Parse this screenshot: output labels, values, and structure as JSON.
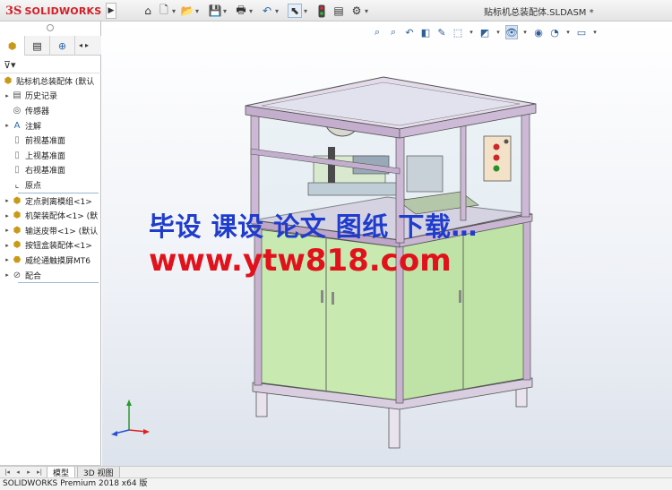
{
  "app": {
    "brand_mark": "3S",
    "brand_name": "SOLIDWORKS",
    "document_title": "贴标机总装配体.SLDASM *"
  },
  "toolbar": {
    "icons": [
      "home-icon",
      "new-file-icon",
      "open-icon",
      "save-icon",
      "print-icon",
      "undo-icon",
      "select-icon",
      "rebuild-icon",
      "file-properties-icon",
      "options-icon"
    ]
  },
  "panel": {
    "tabs": [
      "feature-manager",
      "property-manager"
    ],
    "root_label": "贴标机总装配体 (默认",
    "items": [
      {
        "label": "历史记录",
        "icon": "history-icon",
        "expand": "▸"
      },
      {
        "label": "传感器",
        "icon": "sensor-icon",
        "expand": ""
      },
      {
        "label": "注解",
        "icon": "annotation-icon",
        "expand": "▸"
      },
      {
        "label": "前视基准面",
        "icon": "plane-icon",
        "expand": ""
      },
      {
        "label": "上视基准面",
        "icon": "plane-icon",
        "expand": ""
      },
      {
        "label": "右视基准面",
        "icon": "plane-icon",
        "expand": ""
      },
      {
        "label": "原点",
        "icon": "origin-icon",
        "expand": ""
      },
      {
        "label": "定点剥离模组<1>",
        "icon": "subassembly-icon",
        "expand": "▸"
      },
      {
        "label": "机架装配体<1> (默",
        "icon": "subassembly-icon",
        "expand": "▸"
      },
      {
        "label": "输送皮带<1> (默认",
        "icon": "subassembly-icon",
        "expand": "▸"
      },
      {
        "label": "按钮盒装配体<1>",
        "icon": "subassembly-icon",
        "expand": "▸"
      },
      {
        "label": "威纶通触摸屏MT6",
        "icon": "part-icon",
        "expand": "▸"
      },
      {
        "label": "配合",
        "icon": "mates-icon",
        "expand": "▸"
      }
    ]
  },
  "bottom_tabs": {
    "model": "模型",
    "view3d": "3D 视图"
  },
  "status": {
    "text": "SOLIDWORKS Premium 2018 x64 版"
  },
  "watermark": {
    "line1": "毕设 课设 论文 图纸 下载…",
    "line2": "www.ytw818.com",
    "small": "ytw818.com"
  },
  "colors": {
    "brand": "#d21f26",
    "watermark_blue": "#1f3ccc",
    "watermark_red": "#e0121b",
    "panel_green": "#c8eab0",
    "frame_purple": "#b89cc4"
  }
}
